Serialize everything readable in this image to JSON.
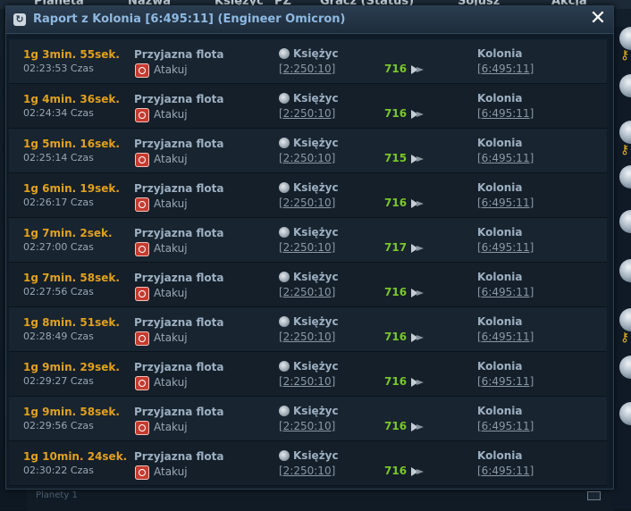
{
  "background": {
    "columns": [
      "Planeta",
      "Nazwa",
      "Księżyc",
      "PZ",
      "Gracz (Status)",
      "Sojusz",
      "Akcja"
    ],
    "footer_text": "Planety 1"
  },
  "dialog": {
    "title": "Raport z Kolonia [6:495:11] (Engineer Omicron)",
    "close_label": "✕",
    "icon": "refresh-icon"
  },
  "rows": [
    {
      "time": "1g 3min. 55sek.",
      "clock": "02:23:53 Czas",
      "fleet": "Przyjazna flota",
      "mission": "Atakuj",
      "origin_name": "Księżyc",
      "origin_coords": "[2:250:10]",
      "ships": "716",
      "dest_name": "Kolonia",
      "dest_coords": "[6:495:11]"
    },
    {
      "time": "1g 4min. 36sek.",
      "clock": "02:24:34 Czas",
      "fleet": "Przyjazna flota",
      "mission": "Atakuj",
      "origin_name": "Księżyc",
      "origin_coords": "[2:250:10]",
      "ships": "716",
      "dest_name": "Kolonia",
      "dest_coords": "[6:495:11]"
    },
    {
      "time": "1g 5min. 16sek.",
      "clock": "02:25:14 Czas",
      "fleet": "Przyjazna flota",
      "mission": "Atakuj",
      "origin_name": "Księżyc",
      "origin_coords": "[2:250:10]",
      "ships": "715",
      "dest_name": "Kolonia",
      "dest_coords": "[6:495:11]"
    },
    {
      "time": "1g 6min. 19sek.",
      "clock": "02:26:17 Czas",
      "fleet": "Przyjazna flota",
      "mission": "Atakuj",
      "origin_name": "Księżyc",
      "origin_coords": "[2:250:10]",
      "ships": "716",
      "dest_name": "Kolonia",
      "dest_coords": "[6:495:11]"
    },
    {
      "time": "1g 7min. 2sek.",
      "clock": "02:27:00 Czas",
      "fleet": "Przyjazna flota",
      "mission": "Atakuj",
      "origin_name": "Księżyc",
      "origin_coords": "[2:250:10]",
      "ships": "717",
      "dest_name": "Kolonia",
      "dest_coords": "[6:495:11]"
    },
    {
      "time": "1g 7min. 58sek.",
      "clock": "02:27:56 Czas",
      "fleet": "Przyjazna flota",
      "mission": "Atakuj",
      "origin_name": "Księżyc",
      "origin_coords": "[2:250:10]",
      "ships": "716",
      "dest_name": "Kolonia",
      "dest_coords": "[6:495:11]"
    },
    {
      "time": "1g 8min. 51sek.",
      "clock": "02:28:49 Czas",
      "fleet": "Przyjazna flota",
      "mission": "Atakuj",
      "origin_name": "Księżyc",
      "origin_coords": "[2:250:10]",
      "ships": "716",
      "dest_name": "Kolonia",
      "dest_coords": "[6:495:11]"
    },
    {
      "time": "1g 9min. 29sek.",
      "clock": "02:29:27 Czas",
      "fleet": "Przyjazna flota",
      "mission": "Atakuj",
      "origin_name": "Księżyc",
      "origin_coords": "[2:250:10]",
      "ships": "716",
      "dest_name": "Kolonia",
      "dest_coords": "[6:495:11]"
    },
    {
      "time": "1g 9min. 58sek.",
      "clock": "02:29:56 Czas",
      "fleet": "Przyjazna flota",
      "mission": "Atakuj",
      "origin_name": "Księżyc",
      "origin_coords": "[2:250:10]",
      "ships": "716",
      "dest_name": "Kolonia",
      "dest_coords": "[6:495:11]"
    },
    {
      "time": "1g 10min. 24sek.",
      "clock": "02:30:22 Czas",
      "fleet": "Przyjazna flota",
      "mission": "Atakuj",
      "origin_name": "Księżyc",
      "origin_coords": "[2:250:10]",
      "ships": "716",
      "dest_name": "Kolonia",
      "dest_coords": "[6:495:11]"
    }
  ],
  "colors": {
    "time": "#e0a020",
    "ships": "#7bc62a",
    "title": "#8fb8e0",
    "attack": "#c53b30"
  }
}
